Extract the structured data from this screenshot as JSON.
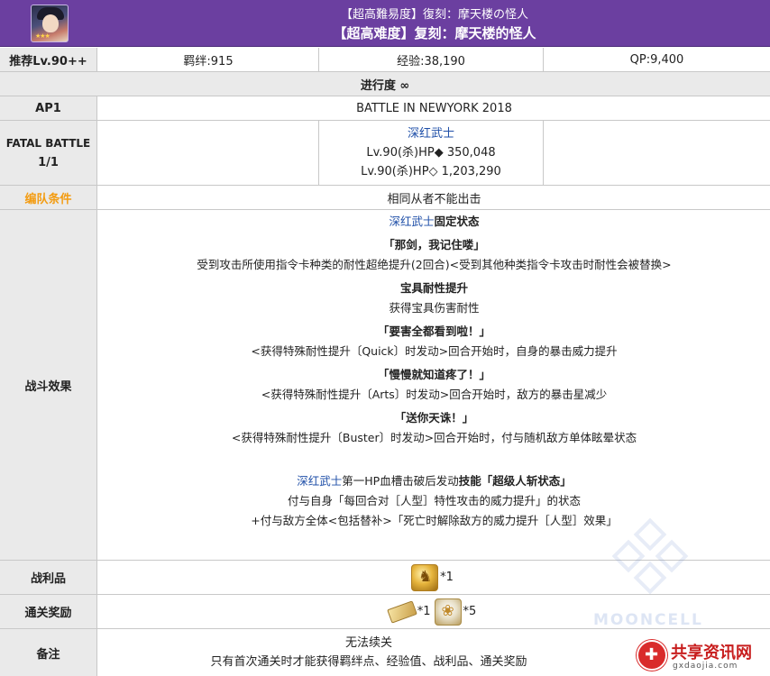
{
  "header": {
    "title_jp": "【超高難易度】復刻：摩天楼の怪人",
    "title_cn": "【超高难度】复刻：摩天楼的怪人"
  },
  "info_row": {
    "level": "推荐Lv.90++",
    "bond": "羁绊:915",
    "exp": "经验:38,190",
    "qp": "QP:9,400"
  },
  "progress": "进行度 ∞",
  "ap_row": {
    "label": "AP1",
    "value": "BATTLE IN NEWYORK 2018"
  },
  "fatal": {
    "label_line1": "FATAL BATTLE",
    "label_line2": "1/1",
    "enemy_name": "深红武士",
    "hp_line1": "Lv.90(杀)HP◆ 350,048",
    "hp_line2": "Lv.90(杀)HP◇ 1,203,290"
  },
  "formation": {
    "label": "编队条件",
    "value": "相同从者不能出击"
  },
  "battle": {
    "label": "战斗效果",
    "fixed_name": "深红武士",
    "fixed_suffix": "固定状态",
    "s1_title": "「那剑，我记住喽」",
    "s1_desc": "受到攻击所使用指令卡种类的耐性超绝提升(2回合)<受到其他种类指令卡攻击时耐性会被替换>",
    "s2_title": "宝具耐性提升",
    "s2_desc": "获得宝具伤害耐性",
    "s3_title": "「要害全都看到啦！」",
    "s3_desc": "<获得特殊耐性提升〔Quick〕时发动>回合开始时，自身的暴击威力提升",
    "s4_title": "「慢慢就知道疼了！」",
    "s4_desc": "<获得特殊耐性提升〔Arts〕时发动>回合开始时，敌方的暴击星减少",
    "s5_title": "「送你天诛！」",
    "s5_desc": "<获得特殊耐性提升〔Buster〕时发动>回合开始时，付与随机敌方单体眩晕状态",
    "break_name": "深红武士",
    "break_mid": "第一HP血槽击破后发动",
    "break_skill": "技能「超级人斩状态」",
    "break_line2": "付与自身「每回合对［人型］特性攻击的威力提升」的状态",
    "break_line3": "+付与敌方全体<包括替补>「死亡时解除敌方的威力提升［人型］效果」"
  },
  "drops": {
    "label": "战利品",
    "count": "*1"
  },
  "clear": {
    "label": "通关奖励",
    "count1": "*1",
    "count2": "*5"
  },
  "notes": {
    "label": "备注",
    "line1": "无法续关",
    "line2": "只有首次通关时才能获得羁绊点、经验值、战利品、通关奖励"
  },
  "watermark": "MOONCELL",
  "logo": {
    "title": "共享资讯网",
    "sub": "gxdaojia.com"
  },
  "colors": {
    "header": "#6b3fa0",
    "label_bg": "#eaeaea",
    "link_blue": "#1f4fa8",
    "orange": "#f39c12"
  }
}
